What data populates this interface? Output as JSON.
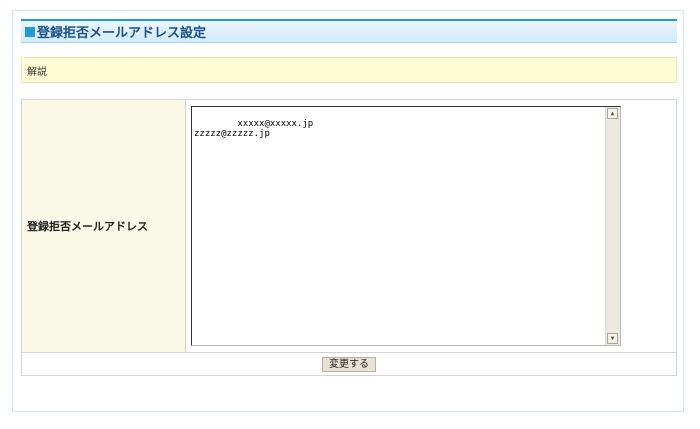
{
  "title": "登録拒否メールアドレス設定",
  "notice": "解説",
  "form": {
    "label": "登録拒否メールアドレス",
    "textarea_value": "xxxxx@xxxxx.jp\nzzzzz@zzzzz.jp",
    "submit_label": "変更する"
  },
  "colors": {
    "accent": "#1f9ad6",
    "title_text": "#1b4f86",
    "notice_bg": "#fffcd6",
    "label_bg": "#faf9e8"
  },
  "icons": {
    "title": "blue-square-icon",
    "scroll_up": "arrow-up-icon",
    "scroll_down": "arrow-down-icon"
  }
}
